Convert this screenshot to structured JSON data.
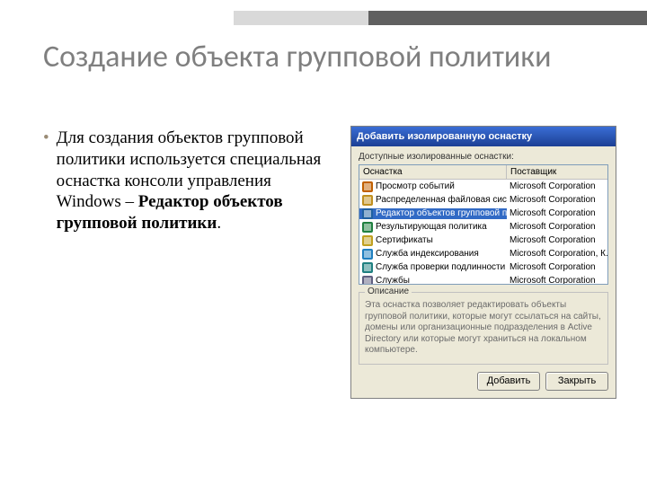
{
  "slide": {
    "title": "Создание объекта групповой политики",
    "bullet_text_pre": "Для создания объектов групповой политики используется специальная оснастка консоли управления Windows – ",
    "bullet_text_strong": "Редактор объектов групповой политики",
    "bullet_text_post": "."
  },
  "dialog": {
    "title": "Добавить изолированную оснастку",
    "available_label": "Доступные изолированные оснастки:",
    "columns": {
      "snapin": "Оснастка",
      "vendor": "Поставщик"
    },
    "rows": [
      {
        "icon": "event-viewer-icon",
        "name": "Просмотр событий",
        "vendor": "Microsoft Corporation"
      },
      {
        "icon": "dfs-icon",
        "name": "Распределенная файловая систем...",
        "vendor": "Microsoft Corporation"
      },
      {
        "icon": "gpo-editor-icon",
        "name": "Редактор объектов групповой поли...",
        "vendor": "Microsoft Corporation",
        "selected": true
      },
      {
        "icon": "rsop-icon",
        "name": "Результирующая политика",
        "vendor": "Microsoft Corporation"
      },
      {
        "icon": "certs-icon",
        "name": "Сертификаты",
        "vendor": "Microsoft Corporation"
      },
      {
        "icon": "index-icon",
        "name": "Служба индексирования",
        "vendor": "Microsoft Corporation, К..."
      },
      {
        "icon": "ipauth-icon",
        "name": "Служба проверки подлинности в И...",
        "vendor": "Microsoft Corporation"
      },
      {
        "icon": "services-icon",
        "name": "Службы",
        "vendor": "Microsoft Corporation"
      }
    ],
    "description": {
      "legend": "Описание",
      "text": "Эта оснастка позволяет редактировать объекты групповой политики, которые могут ссылаться на сайты, домены или организационные подразделения в Active Directory или которые могут храниться на локальном компьютере."
    },
    "buttons": {
      "add": "Добавить",
      "close": "Закрыть"
    }
  }
}
